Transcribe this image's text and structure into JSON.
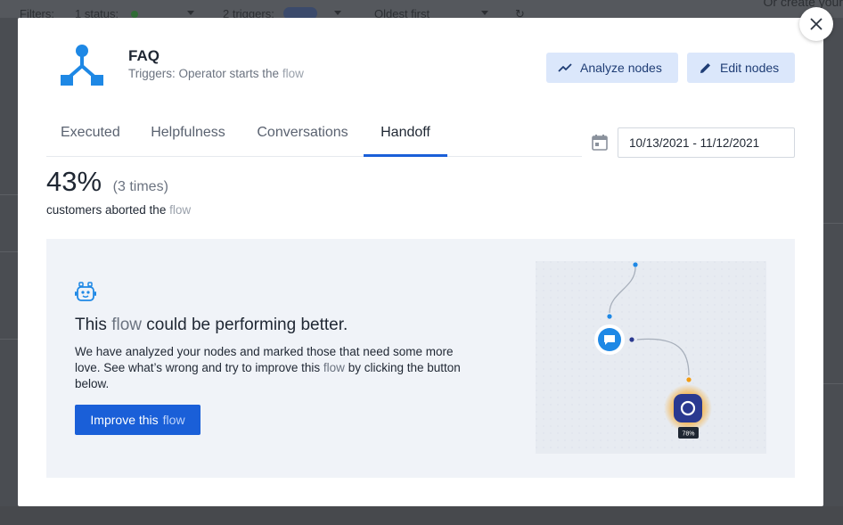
{
  "background": {
    "filters_label": "Filters:",
    "status_filter": "1 status:",
    "triggers_filter": "2 triggers:",
    "sort_label": "Oldest first",
    "corner_text": "Or create your"
  },
  "modal": {
    "close_icon": "close-icon",
    "flow": {
      "name": "FAQ",
      "triggers_prefix": "Triggers: Operator starts the",
      "triggers_word": "flow"
    },
    "buttons": {
      "analyze": "Analyze nodes",
      "edit": "Edit nodes"
    },
    "tabs": [
      {
        "label": "Executed"
      },
      {
        "label": "Helpfulness"
      },
      {
        "label": "Conversations"
      },
      {
        "label": "Handoff",
        "active": true
      }
    ],
    "date_range": "10/13/2021 - 11/12/2021",
    "stat": {
      "value": "43%",
      "times": "(3 times)",
      "description": "customers aborted the",
      "description_word": "flow"
    },
    "panel": {
      "title_prefix": "This",
      "title_word": "flow",
      "title_suffix": "could be performing better.",
      "body_prefix": "We have analyzed your nodes and marked those that need some more love. See what’s wrong and try to improve this",
      "body_word": "flow",
      "body_suffix": "by clicking the button below.",
      "button_prefix": "Improve this",
      "button_word": "flow",
      "node_badge": "78%"
    }
  },
  "colors": {
    "accent": "#1a5fd8",
    "button_light_bg": "#dbe7fb",
    "logo_blue": "#1e88e5",
    "node_dark": "#2a3990",
    "node_glow": "#f5b041",
    "node_orange": "#f39c12"
  }
}
